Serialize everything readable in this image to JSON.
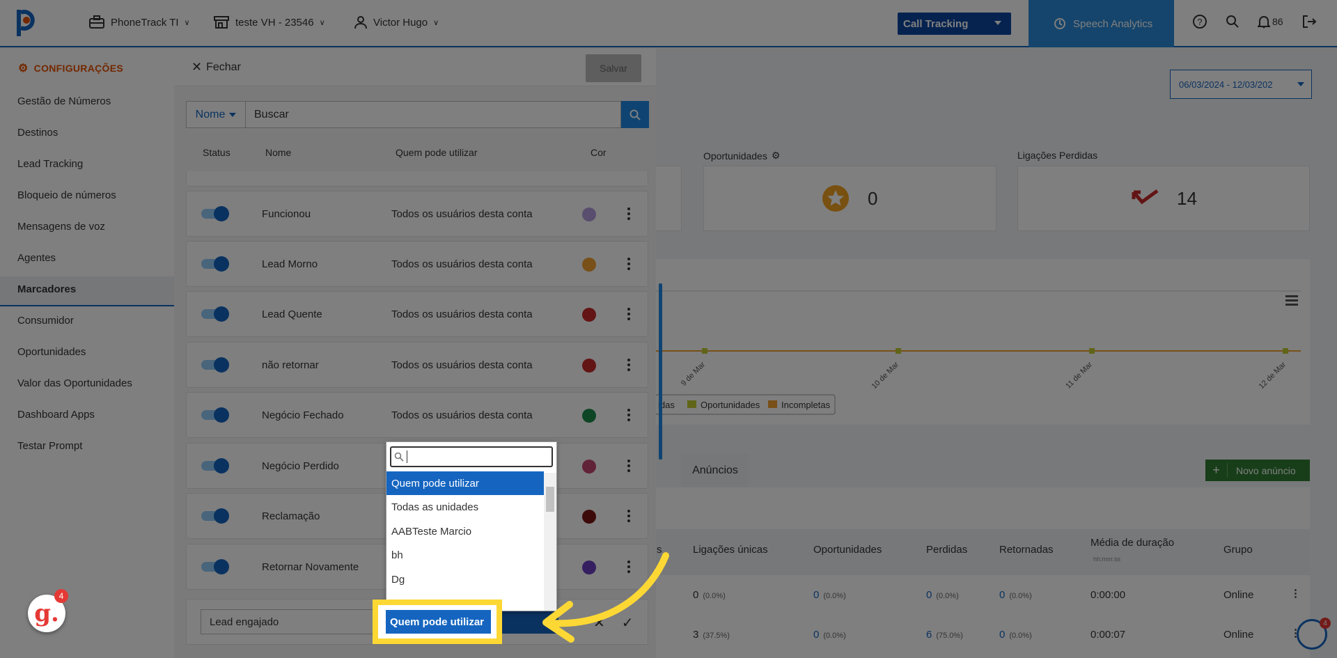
{
  "topbar": {
    "company": "PhoneTrack TI",
    "unit": "teste VH - 23546",
    "user": "Victor Hugo",
    "product": "Call Tracking",
    "speech_analytics": "Speech Analytics",
    "notifications": "86"
  },
  "dashboard": {
    "date_range": "06/03/2024 - 12/03/202",
    "opportunities_label": "Oportunidades",
    "opportunities_value": "0",
    "missed_label": "Ligações Perdidas",
    "missed_value": "14",
    "chart_x_labels": [
      "9 de Mar",
      "10 de Mar",
      "11 de Mar",
      "12 de Mar"
    ],
    "legend": [
      "idas",
      "Oportunidades",
      "Incompletas"
    ],
    "tab_ads": "Anúncios",
    "new_ad": "Novo anúncio",
    "table_headers": [
      "s",
      "Ligações únicas",
      "Oportunidades",
      "Perdidas",
      "Retornadas",
      "Média de duração",
      "Grupo"
    ],
    "duration_sub": "hh:mm:ss",
    "rows": [
      {
        "unique": "0",
        "unique_pct": "(0.0%)",
        "opp": "0",
        "opp_pct": "(0.0%)",
        "lost": "0",
        "lost_pct": "(0.0%)",
        "ret": "0",
        "ret_pct": "(0.0%)",
        "dur": "0:00:00",
        "group": "Online"
      },
      {
        "unique": "3",
        "unique_pct": "(37.5%)",
        "opp": "0",
        "opp_pct": "(0.0%)",
        "lost": "6",
        "lost_pct": "(75.0%)",
        "ret": "0",
        "ret_pct": "(0.0%)",
        "dur": "0:00:07",
        "group": "Online"
      }
    ]
  },
  "sidebar": {
    "title": "CONFIGURAÇÕES",
    "items": [
      "Gestão de Números",
      "Destinos",
      "Lead Tracking",
      "Bloqueio de números",
      "Mensagens de voz",
      "Agentes",
      "Marcadores",
      "Consumidor",
      "Oportunidades",
      "Valor das Oportunidades",
      "Dashboard Apps",
      "Testar Prompt"
    ]
  },
  "panel": {
    "close_label": "Fechar",
    "save_label": "Salvar",
    "filter_label": "Nome",
    "search_placeholder": "Buscar",
    "col_status": "Status",
    "col_name": "Nome",
    "col_who": "Quem pode utilizar",
    "col_color": "Cor",
    "markers": [
      {
        "name": "Funcionou",
        "who": "Todos os usuários desta conta",
        "color": "#b39ddb"
      },
      {
        "name": "Lead Morno",
        "who": "Todos os usuários desta conta",
        "color": "#f0a030"
      },
      {
        "name": "Lead Quente",
        "who": "Todos os usuários desta conta",
        "color": "#c62828"
      },
      {
        "name": "não retornar",
        "who": "Todos os usuários desta conta",
        "color": "#c62828"
      },
      {
        "name": "Negócio Fechado",
        "who": "Todos os usuários desta conta",
        "color": "#1b8a4a"
      },
      {
        "name": "Negócio Perdido",
        "who": "",
        "color": "#c2466e"
      },
      {
        "name": "Reclamação",
        "who": "",
        "color": "#7b1414"
      },
      {
        "name": "Retornar Novamente",
        "who": "",
        "color": "#6a3fc1"
      }
    ],
    "new_marker_name": "Lead engajado"
  },
  "dropdown": {
    "options": [
      "Quem pode utilizar",
      "Todas as unidades",
      "AABTeste Marcio",
      "bh",
      "Dg"
    ],
    "selected": "Quem pode utilizar"
  },
  "widgets": {
    "g_badge": "4",
    "p_badge": "4"
  }
}
